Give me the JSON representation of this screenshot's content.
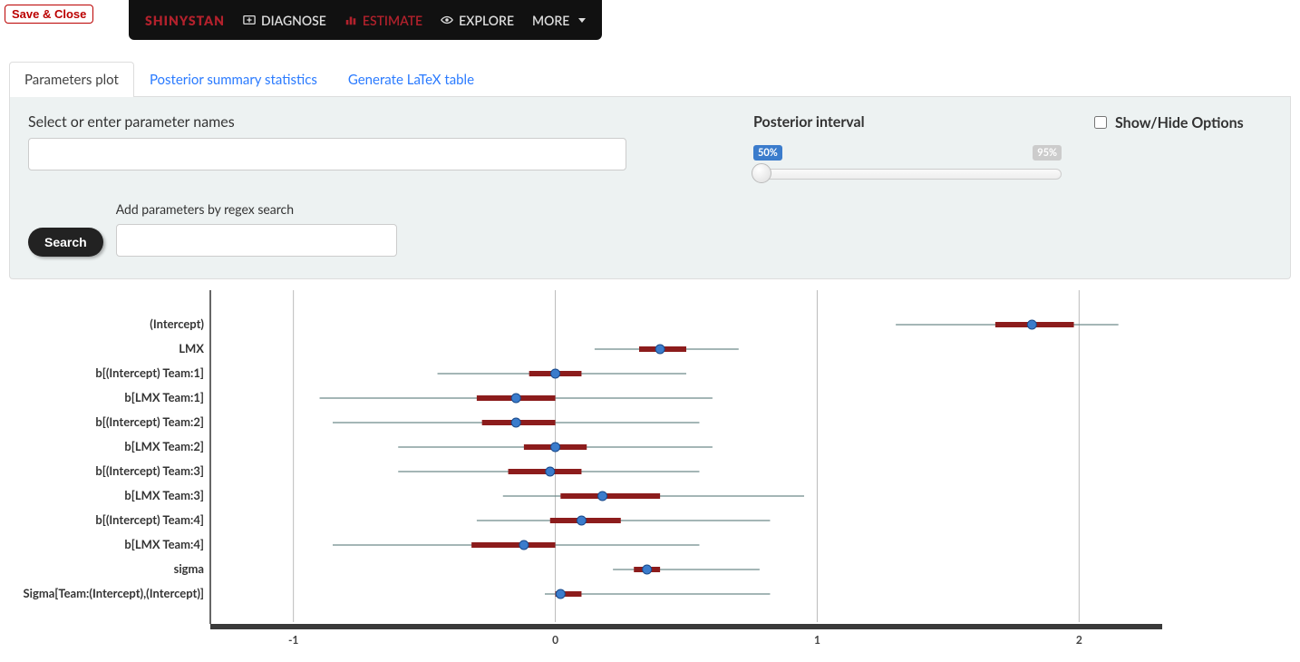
{
  "save_close": "Save & Close",
  "brand": "SHINYSTAN",
  "nav": {
    "diagnose": "DIAGNOSE",
    "estimate": "ESTIMATE",
    "explore": "EXPLORE",
    "more": "MORE"
  },
  "tabs": {
    "params_plot": "Parameters plot",
    "posterior_stats": "Posterior summary statistics",
    "latex": "Generate LaTeX table"
  },
  "panel": {
    "select_label": "Select or enter parameter names",
    "regex_label": "Add parameters by regex search",
    "search_btn": "Search",
    "posterior_interval": "Posterior interval",
    "slider_lo": "50%",
    "slider_hi": "95%",
    "show_hide": "Show/Hide Options"
  },
  "chart_data": {
    "type": "interval-dot",
    "xlabel": "",
    "ylabel": "",
    "xlim": [
      -1.3,
      2.3
    ],
    "xticks": [
      -1,
      0,
      1,
      2
    ],
    "series": [
      {
        "name": "(Intercept)",
        "median": 1.82,
        "inner": [
          1.68,
          1.98
        ],
        "outer": [
          1.3,
          2.15
        ]
      },
      {
        "name": "LMX",
        "median": 0.4,
        "inner": [
          0.32,
          0.5
        ],
        "outer": [
          0.15,
          0.7
        ]
      },
      {
        "name": "b[(Intercept) Team:1]",
        "median": 0.0,
        "inner": [
          -0.1,
          0.1
        ],
        "outer": [
          -0.45,
          0.5
        ]
      },
      {
        "name": "b[LMX Team:1]",
        "median": -0.15,
        "inner": [
          -0.3,
          0.0
        ],
        "outer": [
          -0.9,
          0.6
        ]
      },
      {
        "name": "b[(Intercept) Team:2]",
        "median": -0.15,
        "inner": [
          -0.28,
          0.0
        ],
        "outer": [
          -0.85,
          0.55
        ]
      },
      {
        "name": "b[LMX Team:2]",
        "median": 0.0,
        "inner": [
          -0.12,
          0.12
        ],
        "outer": [
          -0.6,
          0.6
        ]
      },
      {
        "name": "b[(Intercept) Team:3]",
        "median": -0.02,
        "inner": [
          -0.18,
          0.1
        ],
        "outer": [
          -0.6,
          0.55
        ]
      },
      {
        "name": "b[LMX Team:3]",
        "median": 0.18,
        "inner": [
          0.02,
          0.4
        ],
        "outer": [
          -0.2,
          0.95
        ]
      },
      {
        "name": "b[(Intercept) Team:4]",
        "median": 0.1,
        "inner": [
          -0.02,
          0.25
        ],
        "outer": [
          -0.3,
          0.82
        ]
      },
      {
        "name": "b[LMX Team:4]",
        "median": -0.12,
        "inner": [
          -0.32,
          0.0
        ],
        "outer": [
          -0.85,
          0.55
        ]
      },
      {
        "name": "sigma",
        "median": 0.35,
        "inner": [
          0.3,
          0.4
        ],
        "outer": [
          0.22,
          0.78
        ]
      },
      {
        "name": "Sigma[Team:(Intercept),(Intercept)]",
        "median": 0.02,
        "inner": [
          0.0,
          0.1
        ],
        "outer": [
          -0.04,
          0.82
        ]
      }
    ]
  }
}
